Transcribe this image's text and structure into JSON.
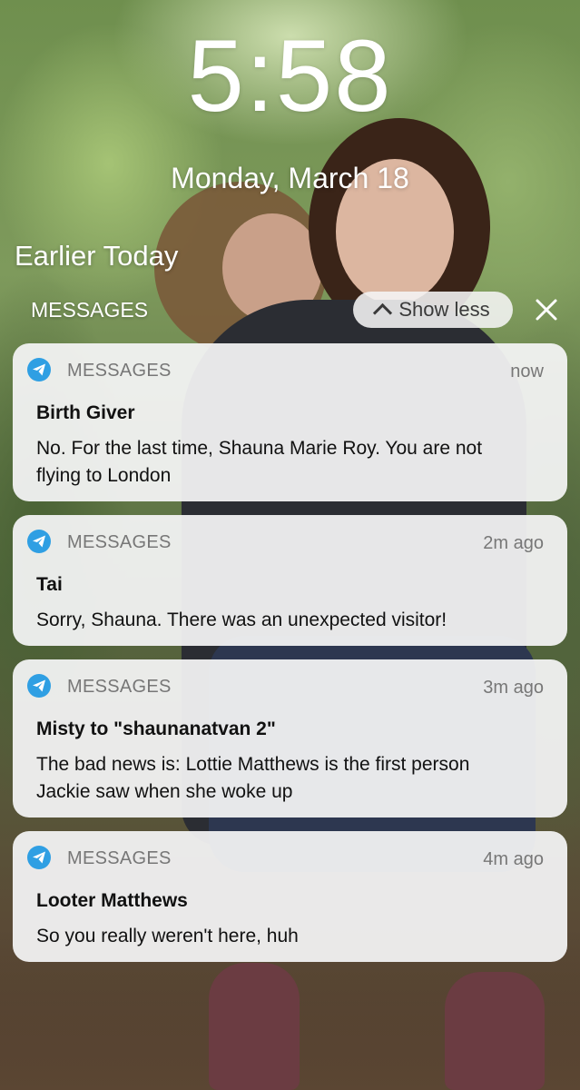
{
  "lockscreen": {
    "time": "5:58",
    "date": "Monday, March 18"
  },
  "section": {
    "title": "Earlier Today",
    "group_label": "MESSAGES",
    "show_less_label": "Show less",
    "show_less_icon": "chevron-up-icon",
    "close_icon": "close-icon"
  },
  "colors": {
    "app_icon": "#2f9fe3",
    "card_background": "#f5f5f6",
    "text_primary": "#111111",
    "text_secondary": "#777777"
  },
  "notifications": [
    {
      "app_name": "MESSAGES",
      "app_icon": "send-icon",
      "time": "now",
      "sender": "Birth Giver",
      "body_lines": [
        "No. For the last time, Shauna Marie Roy. You are not",
        "flying to London"
      ]
    },
    {
      "app_name": "MESSAGES",
      "app_icon": "send-icon",
      "time": "2m ago",
      "sender": "Tai",
      "body_lines": [
        "Sorry, Shauna. There was an unexpected visitor!"
      ]
    },
    {
      "app_name": "MESSAGES",
      "app_icon": "send-icon",
      "time": "3m ago",
      "sender": "Misty to \"shaunanatvan 2\"",
      "body_lines": [
        "The bad news is: Lottie Matthews is the first person",
        "Jackie saw when she woke up"
      ]
    },
    {
      "app_name": "MESSAGES",
      "app_icon": "send-icon",
      "time": "4m ago",
      "sender": "Looter Matthews",
      "body_lines": [
        "So you really weren't here, huh"
      ]
    }
  ]
}
